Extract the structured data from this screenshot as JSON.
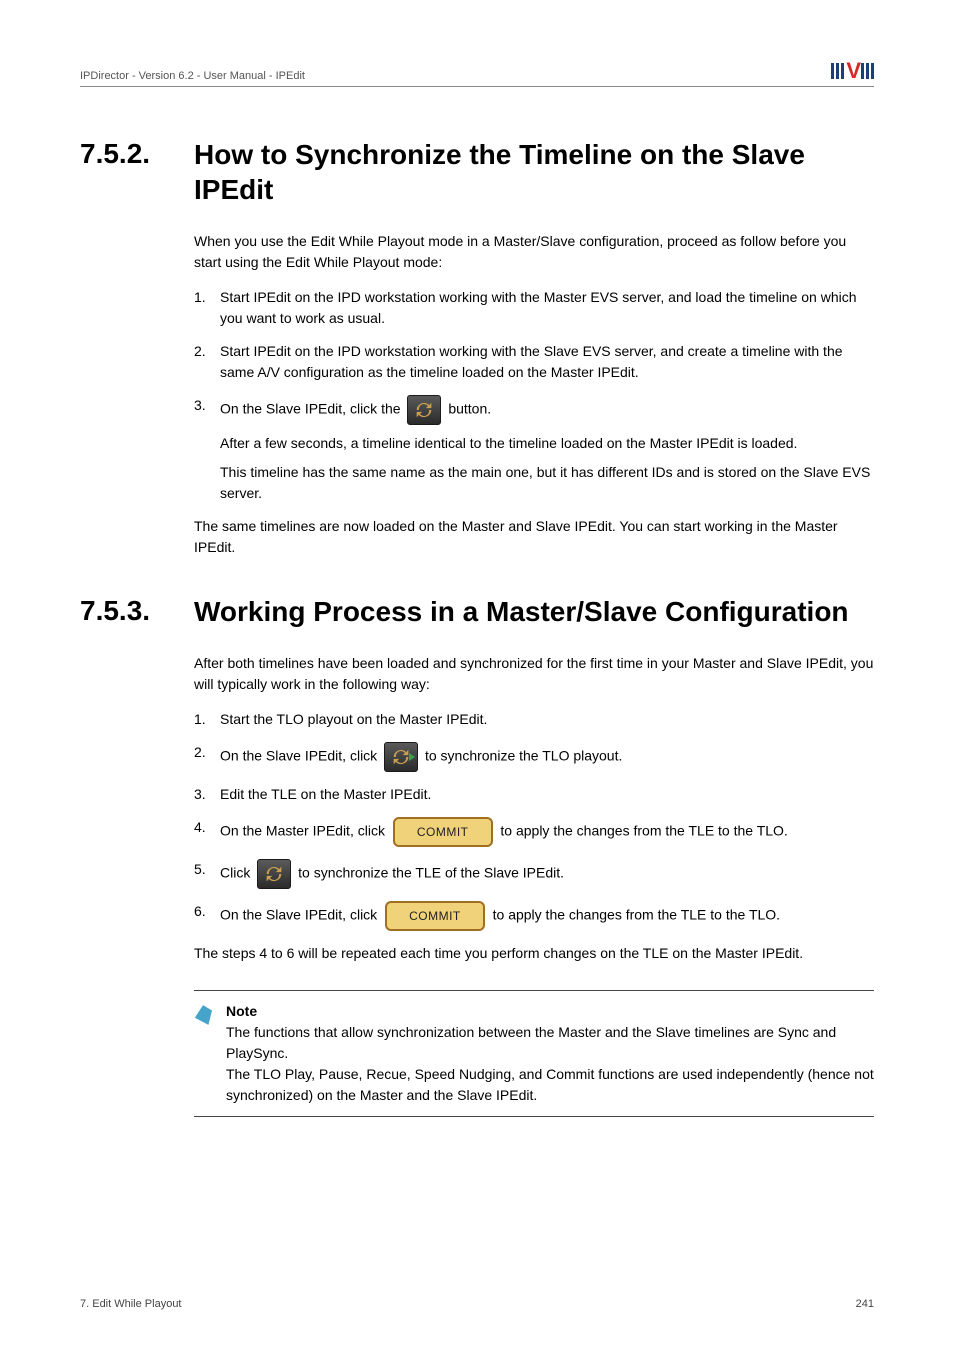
{
  "header": {
    "breadcrumb": "IPDirector - Version 6.2 - User Manual - IPEdit"
  },
  "section1": {
    "number": "7.5.2.",
    "title": "How to Synchronize the Timeline on the Slave IPEdit",
    "intro": "When you use the Edit While Playout mode in a Master/Slave configuration, proceed as follow before you start using the Edit While Playout mode:",
    "steps": {
      "s1": "Start IPEdit on the IPD workstation working with the Master EVS server, and load the timeline on which you want to work as usual.",
      "s2": "Start IPEdit on the IPD workstation working with the Slave EVS server, and create a timeline with the same A/V configuration as the timeline loaded on the Master IPEdit.",
      "s3_pre": "On the Slave IPEdit, click the ",
      "s3_post": " button.",
      "s3_sub1": "After a few seconds, a timeline identical to the timeline loaded on the Master IPEdit is loaded.",
      "s3_sub2": "This timeline has the same name as the main one, but it has different IDs and is stored on the Slave EVS server."
    },
    "outro": "The same timelines are now loaded on the Master and Slave IPEdit. You can start working in the Master IPEdit."
  },
  "section2": {
    "number": "7.5.3.",
    "title": "Working Process in a Master/Slave Configuration",
    "intro": "After both timelines have been loaded and synchronized for the first time in your Master and Slave IPEdit, you will typically work in the following way:",
    "steps": {
      "s1": "Start the TLO playout on the Master IPEdit.",
      "s2_pre": "On the Slave IPEdit, click ",
      "s2_post": " to synchronize the TLO playout.",
      "s3": "Edit the TLE on the Master IPEdit.",
      "s4_pre": "On the Master IPEdit, click ",
      "s4_post": " to apply the changes from the TLE to the TLO.",
      "s5_pre": "Click ",
      "s5_post": " to synchronize the TLE of the Slave IPEdit.",
      "s6_pre": "On the Slave IPEdit, click ",
      "s6_post": " to apply the changes from the TLE to the TLO."
    },
    "outro": "The steps 4 to 6 will be repeated each time you perform changes on the TLE on the Master IPEdit.",
    "note": {
      "title": "Note",
      "line1": "The functions that allow synchronization between the Master and the Slave timelines are Sync and PlaySync.",
      "line2": "The TLO Play, Pause, Recue, Speed Nudging, and Commit functions are used independently (hence not synchronized) on the Master and the Slave IPEdit."
    }
  },
  "buttons": {
    "commit_label": "COMMIT"
  },
  "footer": {
    "left": "7. Edit While Playout",
    "right": "241"
  }
}
